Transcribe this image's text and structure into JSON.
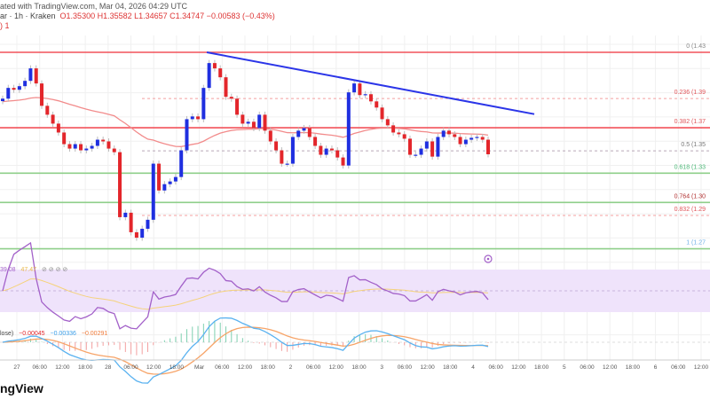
{
  "header": {
    "published": "ated with TradingView.com, Mar 04, 2026 04:29 UTC",
    "symbol_info": "ar · 1h · Kraken",
    "ohlc": "O1.35300  H1.35582  L1.34657  C1.34747  −0.00583 (−0.43%)",
    "indicator_row": ")  1"
  },
  "logo": "ngView",
  "colors": {
    "up": "#1f2fe0",
    "down": "#e3262b",
    "trendline": "#2b35e8",
    "resistance": "#f2525a",
    "support": "#8fcf8a",
    "ema": "#f28b8b",
    "rsi": "#a361c9",
    "rsi_ma": "#f5d27a",
    "rsi_band": "#efe3fb",
    "macd": "#5ab2f0",
    "signal": "#f7a468"
  },
  "chart_data": {
    "type": "candlestick",
    "timeframe": "1h",
    "ylim": [
      1.27,
      1.43
    ],
    "closes": [
      1.3925,
      1.4012,
      1.3997,
      1.4026,
      1.4069,
      1.417,
      1.4048,
      1.3867,
      1.3795,
      1.3723,
      1.3651,
      1.3557,
      1.3521,
      1.3557,
      1.3507,
      1.3521,
      1.3543,
      1.3593,
      1.3579,
      1.3521,
      1.3492,
      1.2966,
      1.3002,
      1.2844,
      1.28,
      1.2872,
      1.2945,
      1.3399,
      1.3182,
      1.3233,
      1.3255,
      1.3291,
      1.3507,
      1.3759,
      1.3781,
      1.3759,
      1.4012,
      1.4213,
      1.417,
      1.4098,
      1.394,
      1.3925,
      1.3795,
      1.3723,
      1.3738,
      1.3687,
      1.3795,
      1.3666,
      1.3579,
      1.3507,
      1.3399,
      1.3399,
      1.3615,
      1.3666,
      1.3687,
      1.3615,
      1.3543,
      1.3471,
      1.3521,
      1.3507,
      1.3449,
      1.3384,
      1.3976,
      1.4048,
      1.3954,
      1.3961,
      1.3903,
      1.3853,
      1.3759,
      1.3709,
      1.3651,
      1.3637,
      1.3601,
      1.3471,
      1.3471,
      1.3521,
      1.3579,
      1.3456,
      1.3615,
      1.3666,
      1.3637,
      1.3615,
      1.3557,
      1.3593,
      1.3608,
      1.3615,
      1.3593,
      1.3475
    ],
    "fib_levels": [
      {
        "label": "0 (1.43",
        "price": 1.43,
        "color": "#888888",
        "line": "#f2525a",
        "style": "solid"
      },
      {
        "label": "0.236 (1.39",
        "price": 1.3926,
        "color": "#e0555a",
        "line": "#f4a0a0",
        "style": "dotted"
      },
      {
        "label": "0.382 (1.37",
        "price": 1.369,
        "color": "#e0555a",
        "line": "#f2525a",
        "style": "solid"
      },
      {
        "label": "0.5 (1.35",
        "price": 1.3503,
        "color": "#777777",
        "line": "#b9a8b8",
        "style": "dotted"
      },
      {
        "label": "0.618 (1.33",
        "price": 1.3322,
        "color": "#4cb877",
        "line": "#8fcf8a",
        "style": "solid"
      },
      {
        "label": "0.764 (1.30",
        "price": 1.3085,
        "color": "#b03030",
        "line": "#8fcf8a",
        "style": "solid"
      },
      {
        "label": "0.832 (1.29",
        "price": 1.298,
        "color": "#e0555a",
        "line": "#f4a0a0",
        "style": "dotted"
      },
      {
        "label": "1 (1.27",
        "price": 1.271,
        "color": "#6fb0e8",
        "line": "#8fcf8a",
        "style": "solid"
      }
    ],
    "trendline": {
      "from_index": 37,
      "from_price": 1.43,
      "to_price": 1.38
    },
    "x_ticks": [
      "27",
      "06:00",
      "12:00",
      "18:00",
      "28",
      "06:00",
      "12:00",
      "18:00",
      "Mar",
      "06:00",
      "12:00",
      "18:00",
      "2",
      "06:00",
      "12:00",
      "18:00",
      "3",
      "06:00",
      "12:00",
      "18:00",
      "4",
      "06:00",
      "12:00",
      "18:00",
      "5",
      "06:00",
      "12:00",
      "18:00",
      "6",
      "06:00",
      "12:00"
    ],
    "rsi": {
      "label_value": "39.08",
      "ma_value": "47.47",
      "extra": "⊘ ⊘ ⊘ ⊘",
      "upper": 70,
      "lower": 30
    },
    "macd": {
      "label": "lose)",
      "hist": "−0.00045",
      "macd": "−0.00336",
      "signal": "−0.00291"
    }
  }
}
